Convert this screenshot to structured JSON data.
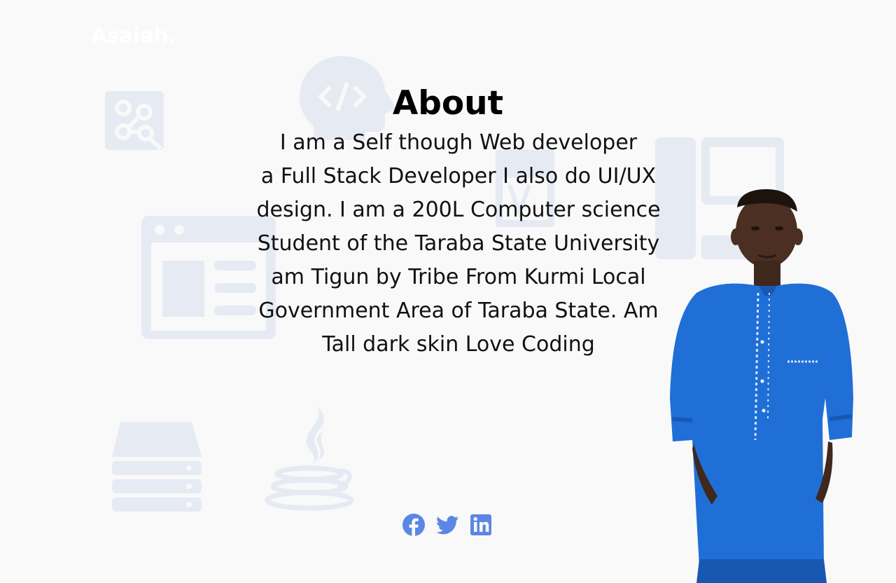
{
  "header": {
    "logo": "Asaiah."
  },
  "about": {
    "title": "About",
    "lines": [
      "I am a Self though Web developer",
      "a Full Stack Developer I also do UI/UX",
      "design. I am a 200L Computer science",
      "Student of the Taraba State University",
      "am Tigun by Tribe From Kurmi Local",
      "Government Area of Taraba State. Am",
      "Tall dark skin Love Coding"
    ]
  },
  "social": {
    "items": [
      {
        "icon": "facebook-icon",
        "color": "#5b86e5"
      },
      {
        "icon": "twitter-icon",
        "color": "#5b86e5"
      },
      {
        "icon": "linkedin-icon",
        "color": "#5b86e5"
      }
    ]
  },
  "colors": {
    "background": "#f9f9fa",
    "decor": "#e6eaf3",
    "accent": "#5b86e5",
    "shirt": "#1f6fd6"
  }
}
